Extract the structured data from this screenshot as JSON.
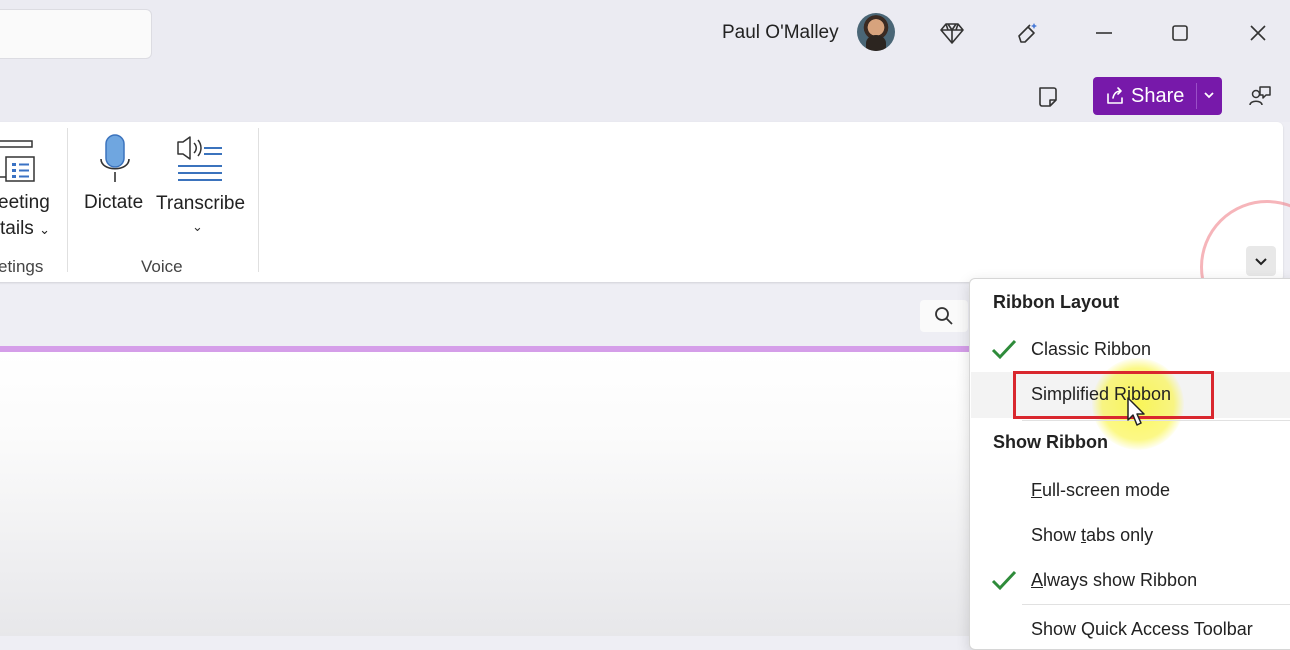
{
  "titlebar": {
    "user_name": "Paul O'Malley",
    "icons": [
      "diamond-icon",
      "pen-sparkle-icon",
      "minimize-icon",
      "maximize-icon",
      "close-icon"
    ]
  },
  "toolbar": {
    "share_label": "Share",
    "share_color": "#7719aa"
  },
  "ribbon": {
    "meeting": {
      "label_line1": "eeting",
      "label_line2": "tails",
      "group_label": "etings"
    },
    "voice": {
      "dictate_label": "Dictate",
      "transcribe_label": "Transcribe",
      "group_label": "Voice"
    }
  },
  "menu": {
    "heading_layout": "Ribbon Layout",
    "classic": "Classic Ribbon",
    "simplified": "Simplified Ribbon",
    "heading_show": "Show Ribbon",
    "fullscreen_pre": "",
    "fullscreen_u": "F",
    "fullscreen_post": "ull-screen mode",
    "tabsonly_pre": "Show ",
    "tabsonly_u": "t",
    "tabsonly_post": "abs only",
    "always_pre": "",
    "always_u": "A",
    "always_post": "lways show Ribbon",
    "quick_access": "Show Quick Access Toolbar",
    "check_color": "#2e8b3a"
  }
}
